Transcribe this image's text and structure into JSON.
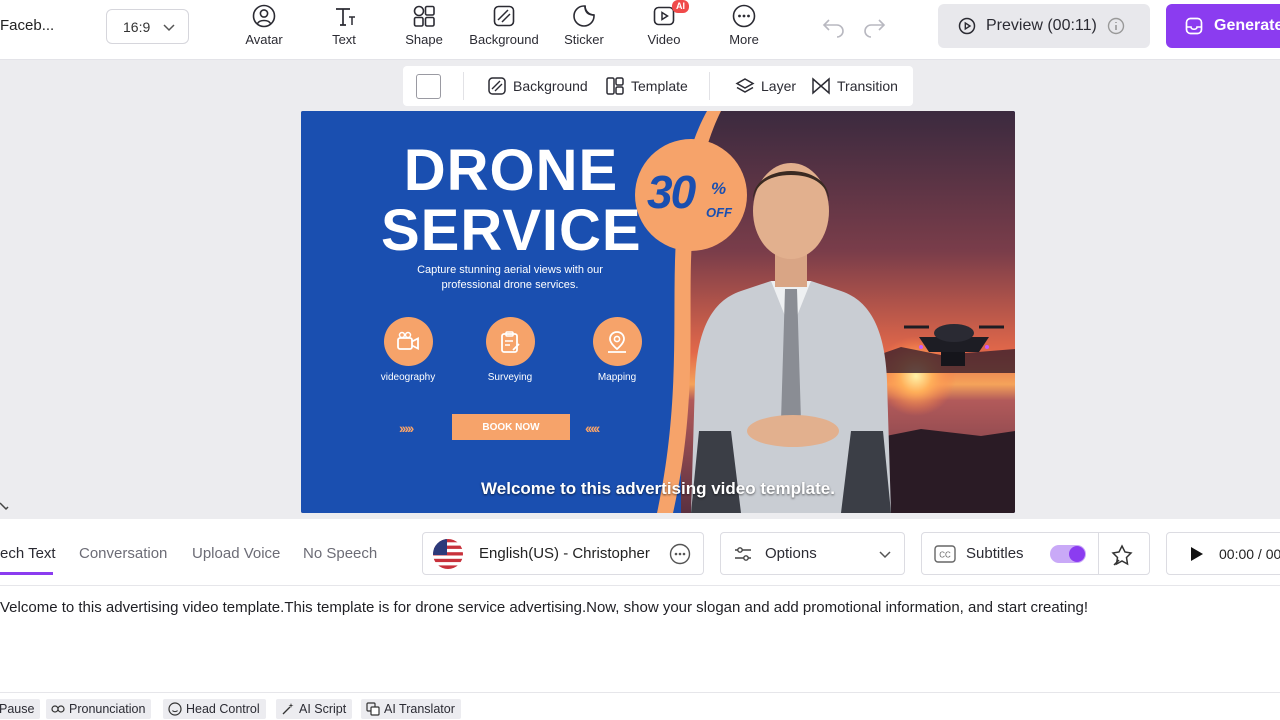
{
  "header": {
    "project_title": "Faceb...",
    "aspect_ratio": "16:9",
    "tools": [
      {
        "label": "Avatar",
        "icon": "avatar-icon"
      },
      {
        "label": "Text",
        "icon": "text-icon"
      },
      {
        "label": "Shape",
        "icon": "shape-icon"
      },
      {
        "label": "Background",
        "icon": "background-icon"
      },
      {
        "label": "Sticker",
        "icon": "sticker-icon"
      },
      {
        "label": "Video",
        "icon": "video-icon",
        "badge": "AI"
      },
      {
        "label": "More",
        "icon": "more-icon"
      }
    ],
    "preview_label": "Preview (00:11)",
    "generate_label": "Generate"
  },
  "canvas_toolbar": {
    "background_label": "Background",
    "template_label": "Template",
    "layer_label": "Layer",
    "transition_label": "Transition"
  },
  "video": {
    "headline_line1": "DRONE",
    "headline_line2": "SERVICE",
    "tagline": "Capture stunning aerial views with our professional drone services.",
    "services": [
      "videography",
      "Surveying",
      "Mapping"
    ],
    "book_label": "BOOK NOW",
    "chevrons_left": "›››››",
    "chevrons_right": "‹‹‹‹‹",
    "discount_number": "30",
    "discount_percent": "%",
    "discount_off": "OFF",
    "caption": "Welcome to this advertising video template."
  },
  "bottom": {
    "tabs": [
      "ech Text",
      "Conversation",
      "Upload Voice",
      "No Speech"
    ],
    "active_tab": "ech Text",
    "voice_label": "English(US) - Christopher",
    "options_label": "Options",
    "subtitles_label": "Subtitles",
    "subtitles_on": true,
    "time_label": "00:00 / 00",
    "script": "Velcome to this advertising video template.This template is for drone service advertising.Now, show your slogan and add promotional information, and start creating!",
    "chips": [
      "Pause",
      "Pronunciation",
      "Head Control",
      "AI Script",
      "AI Translator"
    ]
  },
  "colors": {
    "accent": "#8b3cf0",
    "video_blue": "#1a4fb0",
    "video_orange": "#f6a36a"
  }
}
